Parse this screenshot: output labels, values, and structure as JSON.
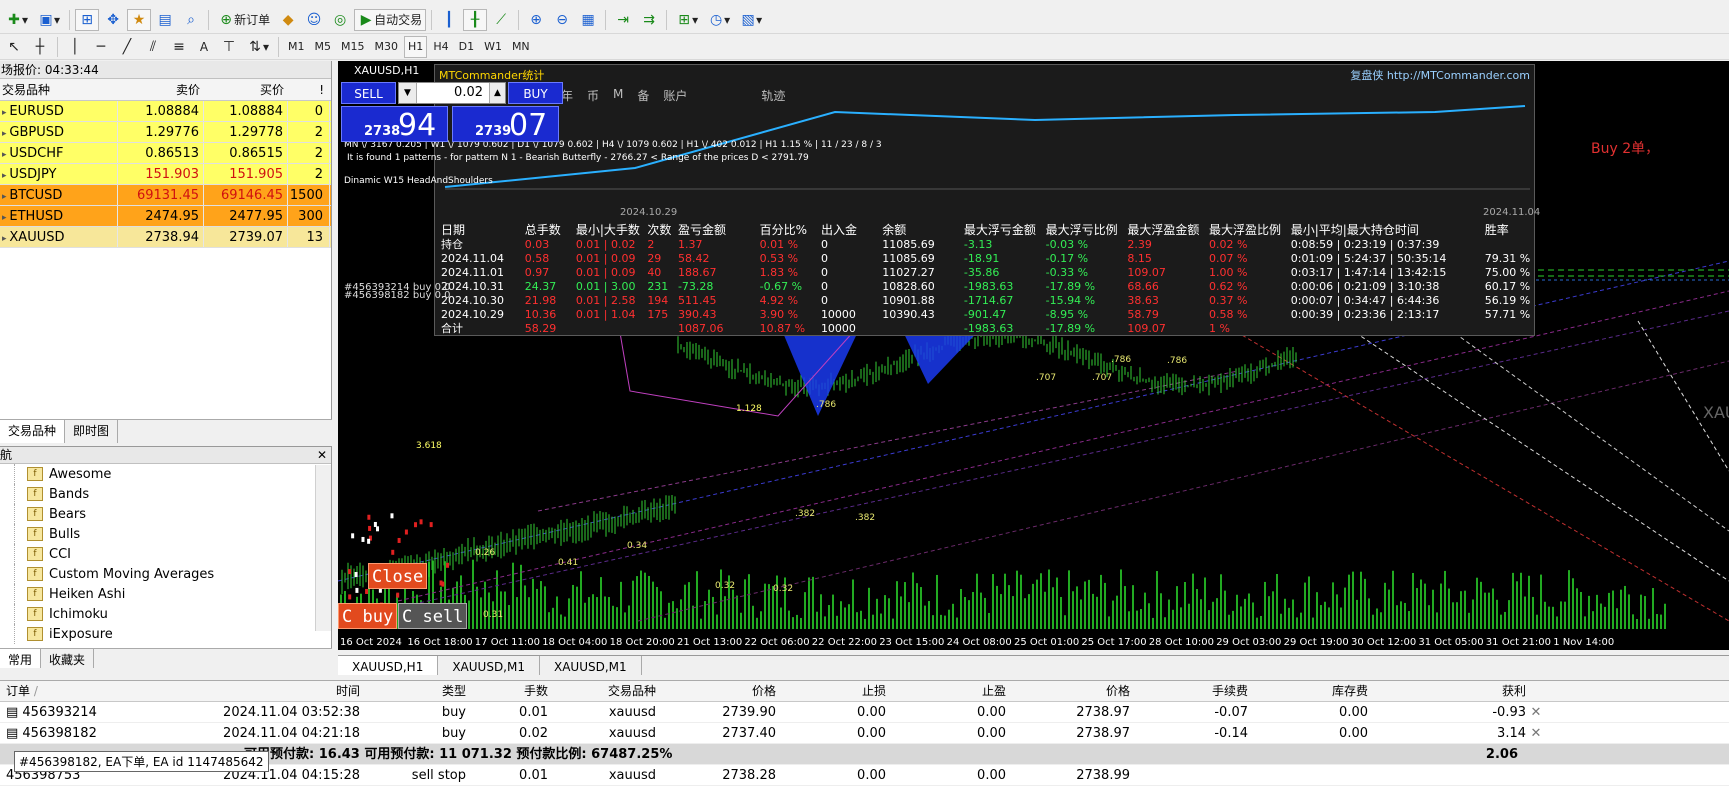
{
  "toolbar": {
    "new_order": "新订单",
    "auto_trade": "自动交易",
    "timeframes": [
      "M1",
      "M5",
      "M15",
      "M30",
      "H1",
      "H4",
      "D1",
      "W1",
      "MN"
    ],
    "active_timeframe": "H1",
    "text_tool": "A"
  },
  "market_watch": {
    "title": "场报价: 04:33:44",
    "col_symbol": "交易品种",
    "col_bid": "卖价",
    "col_ask": "买价",
    "col_spread": "!",
    "rows": [
      {
        "symbol": "EURUSD",
        "bid": "1.08884",
        "ask": "1.08884",
        "spread": "0",
        "bg": "#ffff66",
        "bidColor": "#000000"
      },
      {
        "symbol": "GBPUSD",
        "bid": "1.29776",
        "ask": "1.29778",
        "spread": "2",
        "bg": "#ffff66",
        "bidColor": "#000000"
      },
      {
        "symbol": "USDCHF",
        "bid": "0.86513",
        "ask": "0.86515",
        "spread": "2",
        "bg": "#ffff66",
        "bidColor": "#000000"
      },
      {
        "symbol": "USDJPY",
        "bid": "151.903",
        "ask": "151.905",
        "spread": "2",
        "bg": "#ffff66",
        "bidColor": "#d01010"
      },
      {
        "symbol": "BTCUSD",
        "bid": "69131.45",
        "ask": "69146.45",
        "spread": "1500",
        "bg": "#ffa31a",
        "bidColor": "#d01010"
      },
      {
        "symbol": "ETHUSD",
        "bid": "2474.95",
        "ask": "2477.95",
        "spread": "300",
        "bg": "#ffa31a",
        "bidColor": "#000000"
      },
      {
        "symbol": "XAUUSD",
        "bid": "2738.94",
        "ask": "2739.07",
        "spread": "13",
        "bg": "#f7e79a",
        "bidColor": "#000000"
      }
    ],
    "tabs": [
      "交易品种",
      "即时图"
    ]
  },
  "navigator": {
    "title": "航",
    "items": [
      "Awesome",
      "Bands",
      "Bears",
      "Bulls",
      "CCI",
      "Custom Moving Averages",
      "Heiken Ashi",
      "Ichimoku",
      "iExposure"
    ],
    "tabs": [
      "常用",
      "收藏夹"
    ]
  },
  "chart": {
    "symbol_label": "XAUUSD,H1",
    "right_label": "Buy 2单，",
    "far_right_label": "XAU",
    "x_labels": [
      "16 Oct 2024",
      "16 Oct 18:00",
      "17 Oct 11:00",
      "18 Oct 04:00",
      "18 Oct 20:00",
      "21 Oct 13:00",
      "22 Oct 06:00",
      "22 Oct 22:00",
      "23 Oct 15:00",
      "24 Oct 08:00",
      "25 Oct 01:00",
      "25 Oct 17:00",
      "28 Oct 10:00",
      "29 Oct 03:00",
      "29 Oct 19:00",
      "30 Oct 12:00",
      "31 Oct 05:00",
      "31 Oct 21:00",
      "1 Nov 14:00"
    ],
    "fib_labels": [
      "3.618",
      "1.128",
      ".786",
      ".707",
      ".707",
      ".786",
      ".786",
      ".382",
      ".382",
      "0.34",
      "0.41",
      "0.26",
      "0.32",
      "0.32",
      "0.31"
    ],
    "order_line_labels": [
      "#456393214 buy 0.0",
      "#456398182 buy 0.0"
    ],
    "close_button": "Close",
    "cbuy_button": "C buy",
    "csell_button": "C sell",
    "tabs": [
      "XAUUSD,H1",
      "XAUUSD,M1",
      "XAUUSD,M1"
    ]
  },
  "trade_panel": {
    "sell_label": "SELL",
    "buy_label": "BUY",
    "lot": "0.02",
    "sell_small": "2738",
    "sell_big": "94",
    "buy_small": "2739",
    "buy_big": "07"
  },
  "stats_panel": {
    "title": "MTCommander统计",
    "brand": "复盘侠 http://MTCommander.com",
    "subheader": [
      "年",
      "币",
      "M",
      "备",
      "账户",
      "轨迹"
    ],
    "summary_line": "MN \\/ 3167   0.205  |  W1 \\/ 1079   0.602  |  D1 \\/ 1079   0.602  |  H4 \\/ 1079   0.602  |  H1 \\/ 402   0.012  |  H1  1.15 %  |  11 / 23 / 8 / 3",
    "pattern_line": "It is found 1 patterns  -  for pattern N 1 - Bearish Butterfly - 2766.27 < Range of the prices D < 2791.79",
    "dynamic_line": "Dinamic  W15   HeadAndShoulders",
    "date_start": "2024.10.29",
    "date_end": "2024.11.04",
    "headers": [
      "日期",
      "总手数",
      "最小|大手数",
      "次数",
      "盈亏金额",
      "百分比%",
      "出入金",
      "余额",
      "最大浮亏金额",
      "最大浮亏比例",
      "最大浮盈金额",
      "最大浮盈比例",
      "最小|平均|最大持仓时间",
      "胜率"
    ],
    "rows": [
      {
        "date": "持仓",
        "lots": "0.03",
        "minmax": "0.01 | 0.02",
        "count": "2",
        "pnl": "1.37",
        "pct": "0.01 %",
        "io": "0",
        "bal": "11085.69",
        "mfl": "-3.13",
        "mflp": "-0.03 %",
        "mfp": "2.39",
        "mfpp": "0.02 %",
        "hold": "0:08:59 | 0:23:19 | 0:37:39",
        "win": "",
        "lc": "cr"
      },
      {
        "date": "2024.11.04",
        "lots": "0.58",
        "minmax": "0.01 | 0.09",
        "count": "29",
        "pnl": "58.42",
        "pct": "0.53 %",
        "io": "0",
        "bal": "11085.69",
        "mfl": "-18.91",
        "mflp": "-0.17 %",
        "mfp": "8.15",
        "mfpp": "0.07 %",
        "hold": "0:01:09 | 5:24:37 | 50:35:14",
        "win": "79.31 %",
        "lc": "cr"
      },
      {
        "date": "2024.11.01",
        "lots": "0.97",
        "minmax": "0.01 | 0.09",
        "count": "40",
        "pnl": "188.67",
        "pct": "1.83 %",
        "io": "0",
        "bal": "11027.27",
        "mfl": "-35.86",
        "mflp": "-0.33 %",
        "mfp": "109.07",
        "mfpp": "1.00 %",
        "hold": "0:03:17 | 1:47:14 | 13:42:15",
        "win": "75.00 %",
        "lc": "cr"
      },
      {
        "date": "2024.10.31",
        "lots": "24.37",
        "minmax": "0.01 | 3.00",
        "count": "231",
        "pnl": "-73.28",
        "pct": "-0.67 %",
        "io": "0",
        "bal": "10828.60",
        "mfl": "-1983.63",
        "mflp": "-17.89 %",
        "mfp": "68.66",
        "mfpp": "0.62 %",
        "hold": "0:00:06 | 0:21:09 | 3:10:38",
        "win": "60.17 %",
        "lc": "cg"
      },
      {
        "date": "2024.10.30",
        "lots": "21.98",
        "minmax": "0.01 | 2.58",
        "count": "194",
        "pnl": "511.45",
        "pct": "4.92 %",
        "io": "0",
        "bal": "10901.88",
        "mfl": "-1714.67",
        "mflp": "-15.94 %",
        "mfp": "38.63",
        "mfpp": "0.37 %",
        "hold": "0:00:07 | 0:34:47 | 6:44:36",
        "win": "56.19 %",
        "lc": "cr"
      },
      {
        "date": "2024.10.29",
        "lots": "10.36",
        "minmax": "0.01 | 1.04",
        "count": "175",
        "pnl": "390.43",
        "pct": "3.90 %",
        "io": "10000",
        "bal": "10390.43",
        "mfl": "-901.47",
        "mflp": "-8.95 %",
        "mfp": "58.79",
        "mfpp": "0.58 %",
        "hold": "0:00:39 | 0:23:36 | 2:13:17",
        "win": "57.71 %",
        "lc": "cr"
      },
      {
        "date": "合计",
        "lots": "58.29",
        "minmax": "",
        "count": "",
        "pnl": "1087.06",
        "pct": "10.87 %",
        "io": "10000",
        "bal": "",
        "mfl": "-1983.63",
        "mflp": "-17.89 %",
        "mfp": "109.07",
        "mfpp": "1 %",
        "hold": "",
        "win": "",
        "lc": "cr"
      }
    ]
  },
  "terminal": {
    "headers": {
      "order": "订单",
      "time": "时间",
      "type": "类型",
      "lots": "手数",
      "symbol": "交易品种",
      "price": "价格",
      "sl": "止损",
      "tp": "止盈",
      "cur_price": "价格",
      "comm": "手续费",
      "swap": "库存费",
      "profit": "获利"
    },
    "sort_indicator": "/",
    "orders": [
      {
        "order": "456393214",
        "time": "2024.11.04 03:52:38",
        "type": "buy",
        "lots": "0.01",
        "symbol": "xauusd",
        "price": "2739.90",
        "sl": "0.00",
        "tp": "0.00",
        "cur": "2738.97",
        "comm": "-0.07",
        "swap": "0.00",
        "profit": "-0.93"
      },
      {
        "order": "456398182",
        "time": "2024.11.04 04:21:18",
        "type": "buy",
        "lots": "0.02",
        "symbol": "xauusd",
        "price": "2737.40",
        "sl": "0.00",
        "tp": "0.00",
        "cur": "2738.97",
        "comm": "-0.14",
        "swap": "0.00",
        "profit": "3.14"
      }
    ],
    "balance_line": "可用预付款: 16.43  可用预付款: 11 071.32  预付款比例: 67487.25%",
    "balance_profit": "2.06",
    "pending": {
      "order": "456398753",
      "time": "2024.11.04 04:15:28",
      "type": "sell stop",
      "lots": "0.01",
      "symbol": "xauusd",
      "price": "2738.28",
      "sl": "0.00",
      "tp": "0.00",
      "cur": "2738.99"
    },
    "tooltip": "#456398182, EA下单, EA id 1147485642"
  }
}
